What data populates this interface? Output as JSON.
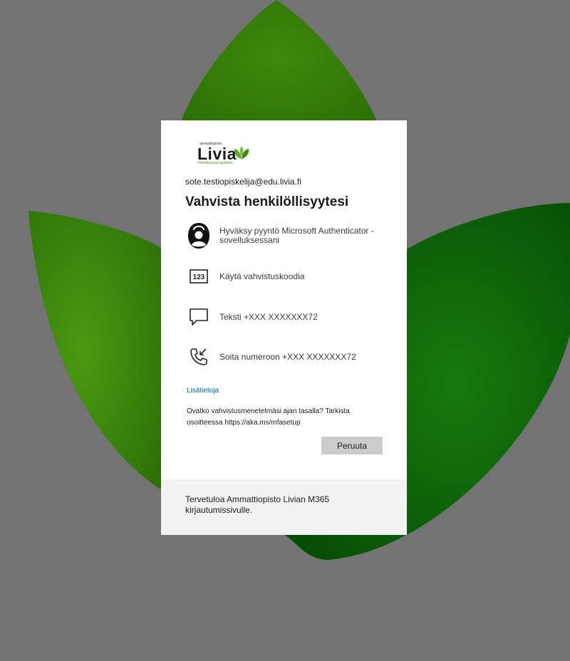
{
  "brand": {
    "logo_tagline": "ammattiopisto",
    "logo_word": "Livia",
    "logo_subtitle": "Helmikuussa opiskelu"
  },
  "signin": {
    "email": "sote.testiopiskelija@edu.livia.fi",
    "title": "Vahvista henkilöllisyytesi",
    "options": [
      {
        "icon": "authenticator-icon",
        "label": "Hyväksy pyyntö Microsoft Authenticator -sovelluksessani"
      },
      {
        "icon": "code-123-icon",
        "label": "Käytä vahvistuskoodia"
      },
      {
        "icon": "message-icon",
        "label": "Teksti +XXX XXXXXXX72"
      },
      {
        "icon": "phone-call-icon",
        "label": "Soita numeroon +XXX XXXXXXX72"
      }
    ],
    "more_info_link": "Lisätietoja",
    "note": "Ovatko vahvistusmenetelmäsi ajan tasalla? Tarkista osoitteessa https://aka.ms/mfasetup",
    "cancel_label": "Peruuta"
  },
  "footer": {
    "text": "Tervetuloa Ammattiopisto Livian M365 kirjautumissivulle."
  },
  "colors": {
    "background": "#737373",
    "leaf_green": "#2e7d07",
    "link": "#0067b8",
    "button": "#cccccc"
  }
}
